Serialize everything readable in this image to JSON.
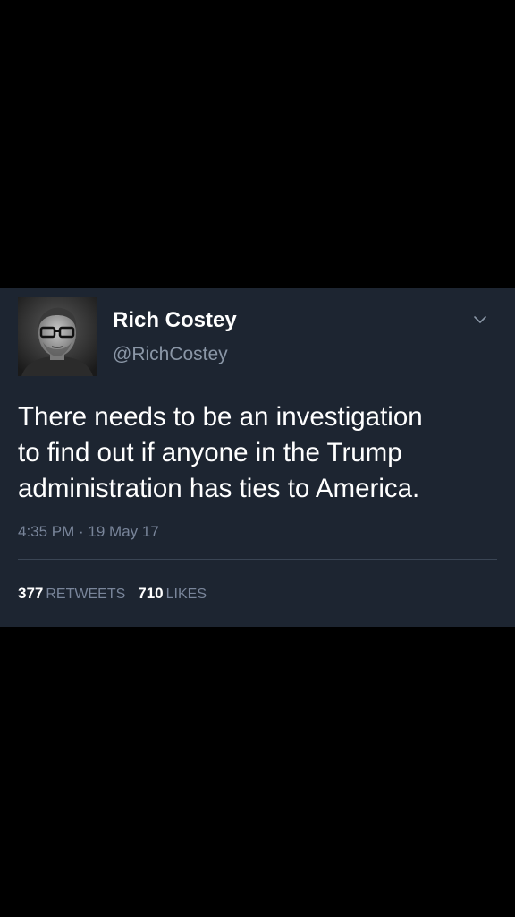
{
  "tweet": {
    "author": {
      "display_name": "Rich Costey",
      "handle": "@RichCostey",
      "avatar_icon": "profile-photo"
    },
    "menu_icon": "chevron-down-icon",
    "text_lines": [
      "There needs to be an investigation",
      "to find out if anyone in the Trump",
      "administration has ties to America."
    ],
    "timestamp": "4:35 PM · 19 May 17",
    "stats": {
      "retweets_count": "377",
      "retweets_label": "RETWEETS",
      "likes_count": "710",
      "likes_label": "LIKES"
    }
  },
  "colors": {
    "page_background": "#000000",
    "card_background": "#1d2531",
    "primary_text": "#ffffff",
    "secondary_text": "#8a96a6",
    "divider": "#3a4554"
  }
}
